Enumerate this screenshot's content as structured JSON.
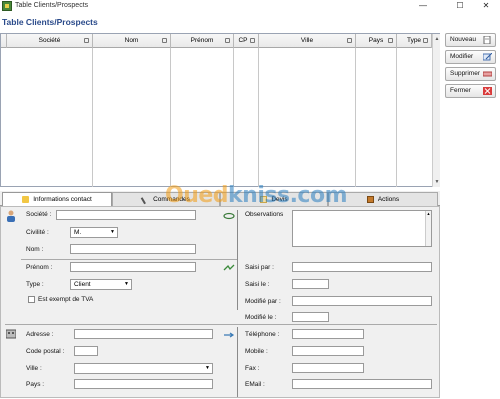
{
  "window": {
    "title": "Table Clients/Prospects",
    "minimize": "—",
    "maximize": "☐",
    "close": "✕"
  },
  "header": {
    "label": "Table Clients/Prospects"
  },
  "grid": {
    "columns": [
      "Société",
      "Nom",
      "Prénom",
      "CP",
      "Ville",
      "Pays",
      "Type"
    ],
    "rows": []
  },
  "actions": {
    "nouveau": "Nouveau",
    "modifier": "Modifier",
    "supprimer": "Supprimer",
    "fermer": "Fermer"
  },
  "tabs": [
    "Informations contact",
    "Commandes",
    "Devis",
    "Actions"
  ],
  "form": {
    "societe": {
      "label": "Société :",
      "value": ""
    },
    "civilite": {
      "label": "Civilité :",
      "value": "M."
    },
    "nom": {
      "label": "Nom :",
      "value": ""
    },
    "prenom": {
      "label": "Prénom :",
      "value": ""
    },
    "type": {
      "label": "Type :",
      "value": "Client"
    },
    "exempt_tva": {
      "label": "Est exempt de TVA",
      "checked": false
    },
    "observations": {
      "label": "Observations",
      "value": ""
    },
    "saisi_par": {
      "label": "Saisi par :",
      "value": ""
    },
    "saisi_le": {
      "label": "Saisi le :",
      "value": ""
    },
    "modifie_par": {
      "label": "Modifié par :",
      "value": ""
    },
    "modifie_le": {
      "label": "Modifié le :",
      "value": ""
    },
    "adresse": {
      "label": "Adresse :",
      "value": ""
    },
    "code_postal": {
      "label": "Code postal :",
      "value": ""
    },
    "ville": {
      "label": "Ville :",
      "value": ""
    },
    "pays": {
      "label": "Pays :",
      "value": ""
    },
    "telephone": {
      "label": "Téléphone :",
      "value": ""
    },
    "mobile": {
      "label": "Mobile :",
      "value": ""
    },
    "fax": {
      "label": "Fax :",
      "value": ""
    },
    "email": {
      "label": "EMail :",
      "value": ""
    }
  },
  "watermark": {
    "part1": "Oued",
    "part2": "kniss",
    "part3": ".com"
  },
  "colors": {
    "accent": "#2a4a8a",
    "watermark_orange": "#f39c12",
    "watermark_blue": "#2b7fc1"
  }
}
